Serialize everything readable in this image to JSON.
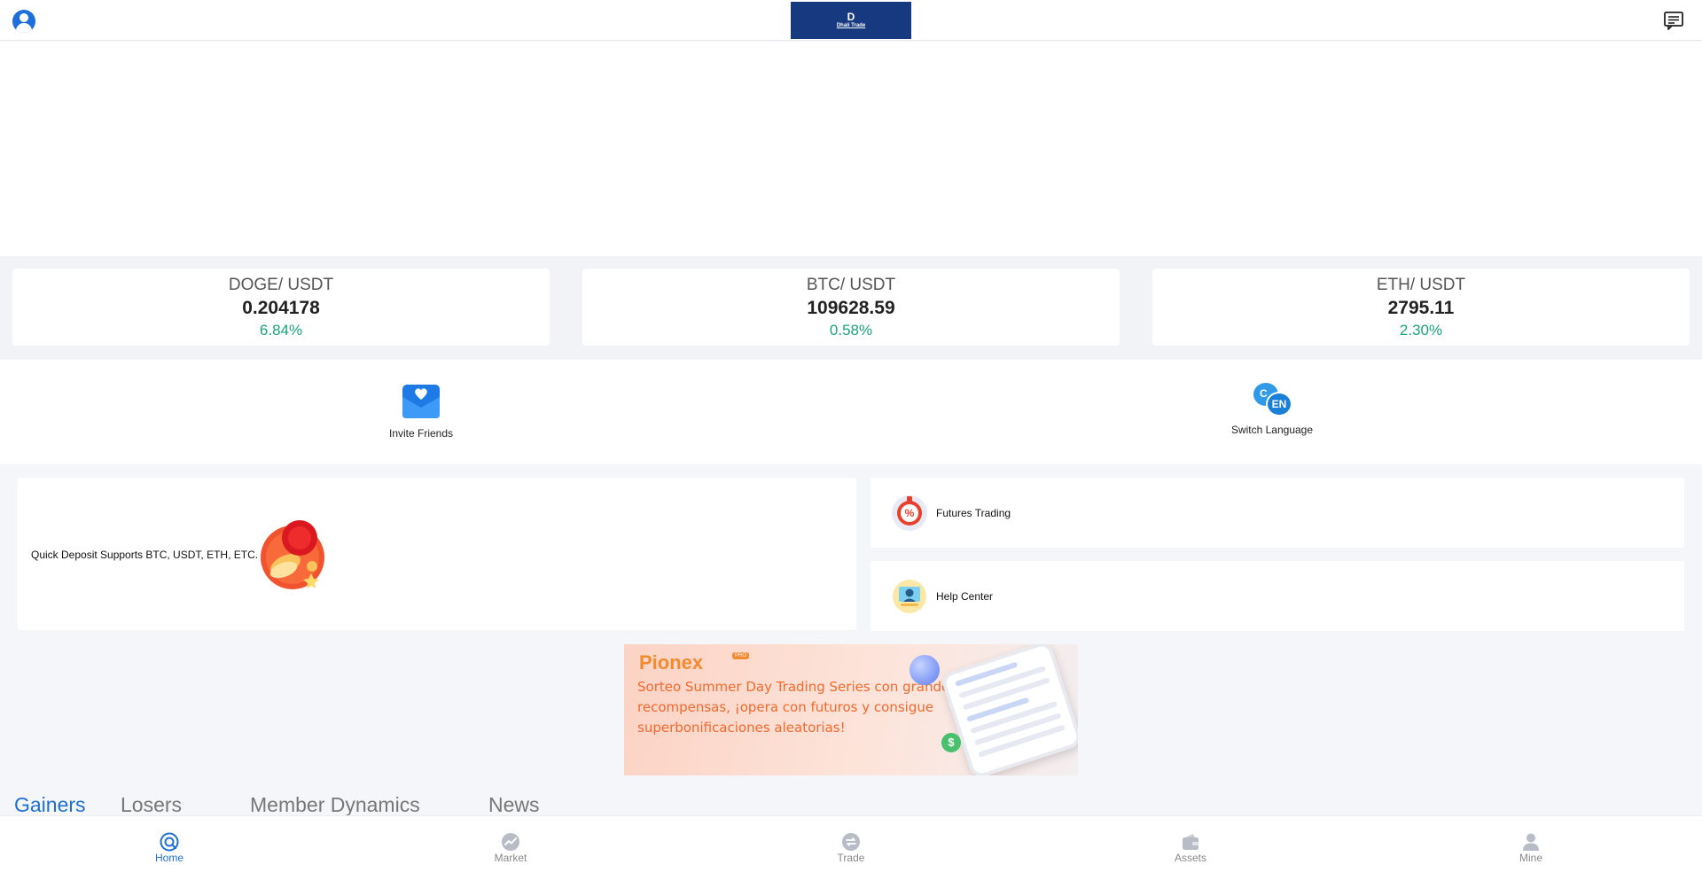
{
  "header": {
    "logo_mark": "D",
    "logo_text": "Dhali Trade"
  },
  "tickers": [
    {
      "pair": "DOGE/ USDT",
      "price": "0.204178",
      "change": "6.84%"
    },
    {
      "pair": "BTC/ USDT",
      "price": "109628.59",
      "change": "0.58%"
    },
    {
      "pair": "ETH/ USDT",
      "price": "2795.11",
      "change": "2.30%"
    }
  ],
  "quick_links": {
    "invite": "Invite Friends",
    "language": "Switch Language",
    "language_badge_c": "C",
    "language_badge_en": "EN"
  },
  "features": {
    "quick_deposit": "Quick Deposit Supports BTC, USDT, ETH, ETC.",
    "futures": "Futures Trading",
    "futures_badge": "%",
    "help": "Help Center"
  },
  "promo": {
    "brand": "Pionex",
    "brand_badge": "PRO",
    "text": "Sorteo Summer Day Trading Series con grandes recompensas, ¡opera con futuros y consigue superbonificaciones aleatorias!",
    "coin": "$"
  },
  "tabs": [
    "Gainers",
    "Losers",
    "Member Dynamics",
    "News"
  ],
  "bottom_nav": {
    "home": "Home",
    "market": "Market",
    "trade": "Trade",
    "assets": "Assets",
    "mine": "Mine"
  },
  "colors": {
    "accent": "#1f6fd0",
    "positive": "#1aa37a",
    "logo_bg": "#17397f",
    "promo_text": "#f2692e"
  }
}
